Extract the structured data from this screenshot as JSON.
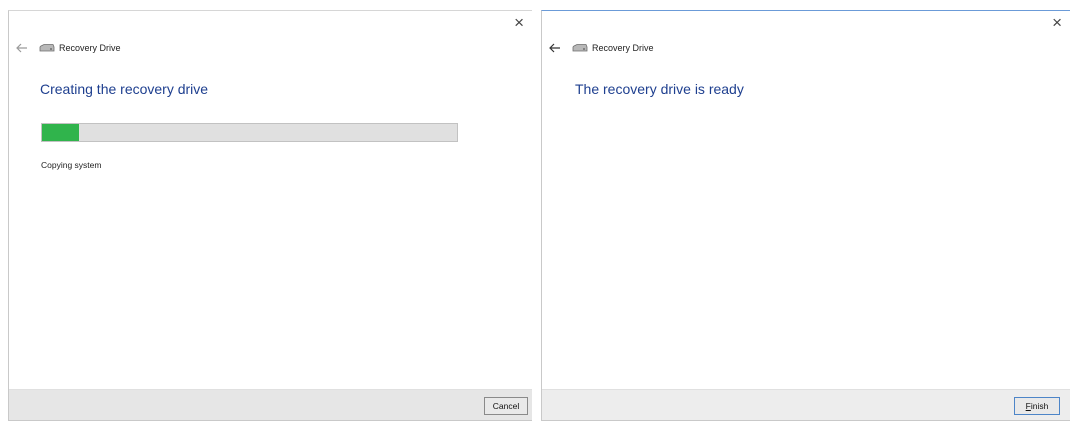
{
  "left_dialog": {
    "close_glyph": "×",
    "back_icon": "back-arrow-icon",
    "drive_icon": "drive-icon",
    "wizard_title": "Recovery Drive",
    "heading": "Creating the recovery drive",
    "progress_fraction": 0.09,
    "status": "Copying system",
    "cancel_label": "Cancel"
  },
  "right_dialog": {
    "close_glyph": "×",
    "back_icon": "back-arrow-icon",
    "drive_icon": "drive-icon",
    "wizard_title": "Recovery Drive",
    "heading": "The recovery drive is ready",
    "finish_mnemonic": "F",
    "finish_rest": "inish"
  },
  "colors": {
    "heading": "#1e3f8f",
    "progress_fill": "#30b44c",
    "progress_track": "#e0e0e0"
  }
}
